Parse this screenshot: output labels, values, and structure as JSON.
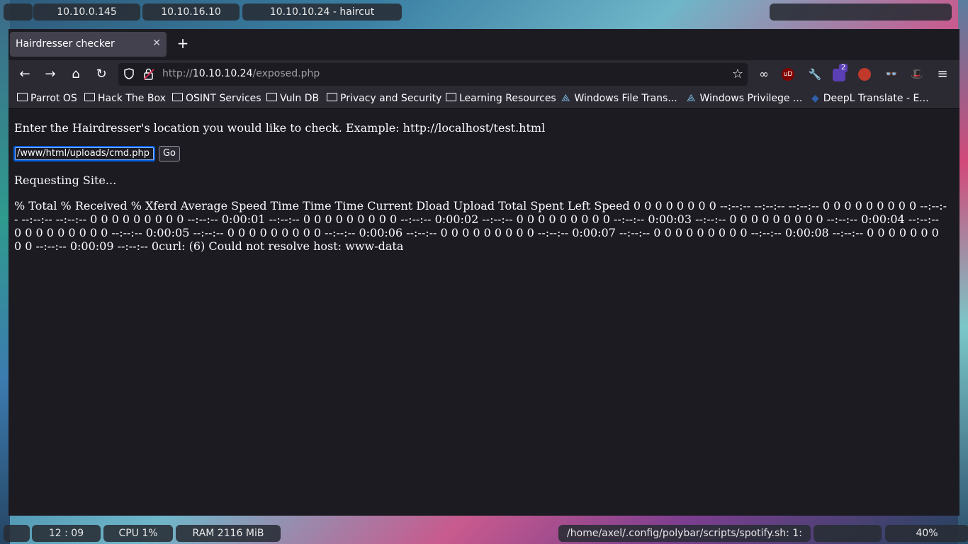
{
  "topbar": {
    "workspaces": [
      "10.10.0.145",
      "10.10.16.10",
      "10.10.10.24 - haircut"
    ]
  },
  "browser": {
    "tab_title": "Hairdresser checker",
    "url_prefix": "http://",
    "url_host": "10.10.10.24",
    "url_path": "/exposed.php",
    "bookmarks": [
      "Parrot OS",
      "Hack The Box",
      "OSINT Services",
      "Vuln DB",
      "Privacy and Security",
      "Learning Resources",
      "Windows File Trans...",
      "Windows Privilege ...",
      "DeepL Translate - E..."
    ],
    "extension_badge": "2"
  },
  "page": {
    "instruction": "Enter the Hairdresser's location you would like to check. Example: http://localhost/test.html",
    "input_value": "/www/html/uploads/cmd.php",
    "go_label": "Go",
    "status": "Requesting Site...",
    "output": "% Total % Received % Xferd Average Speed Time Time Time Current Dload Upload Total Spent Left Speed 0 0 0 0 0 0 0 0 --:--:-- --:--:-- --:--:-- 0 0 0 0 0 0 0 0 0 --:--:-- --:--:-- --:--:-- 0 0 0 0 0 0 0 0 0 --:--:-- 0:00:01 --:--:-- 0 0 0 0 0 0 0 0 0 --:--:-- 0:00:02 --:--:-- 0 0 0 0 0 0 0 0 0 --:--:-- 0:00:03 --:--:-- 0 0 0 0 0 0 0 0 0 --:--:-- 0:00:04 --:--:-- 0 0 0 0 0 0 0 0 0 --:--:-- 0:00:05 --:--:-- 0 0 0 0 0 0 0 0 0 --:--:-- 0:00:06 --:--:-- 0 0 0 0 0 0 0 0 0 --:--:-- 0:00:07 --:--:-- 0 0 0 0 0 0 0 0 0 --:--:-- 0:00:08 --:--:-- 0 0 0 0 0 0 0 0 0 --:--:-- 0:00:09 --:--:-- 0curl: (6) Could not resolve host: www-data"
  },
  "bottombar": {
    "clock": "12 : 09",
    "cpu": "CPU 1%",
    "ram": "RAM 2116 MiB",
    "spotify": "/home/axel/.config/polybar/scripts/spotify.sh: 1:",
    "volume": "40%"
  },
  "colors": {
    "accent": "#0060df",
    "window_bg": "#1c1b22",
    "toolbar_bg": "#2b2a33"
  }
}
